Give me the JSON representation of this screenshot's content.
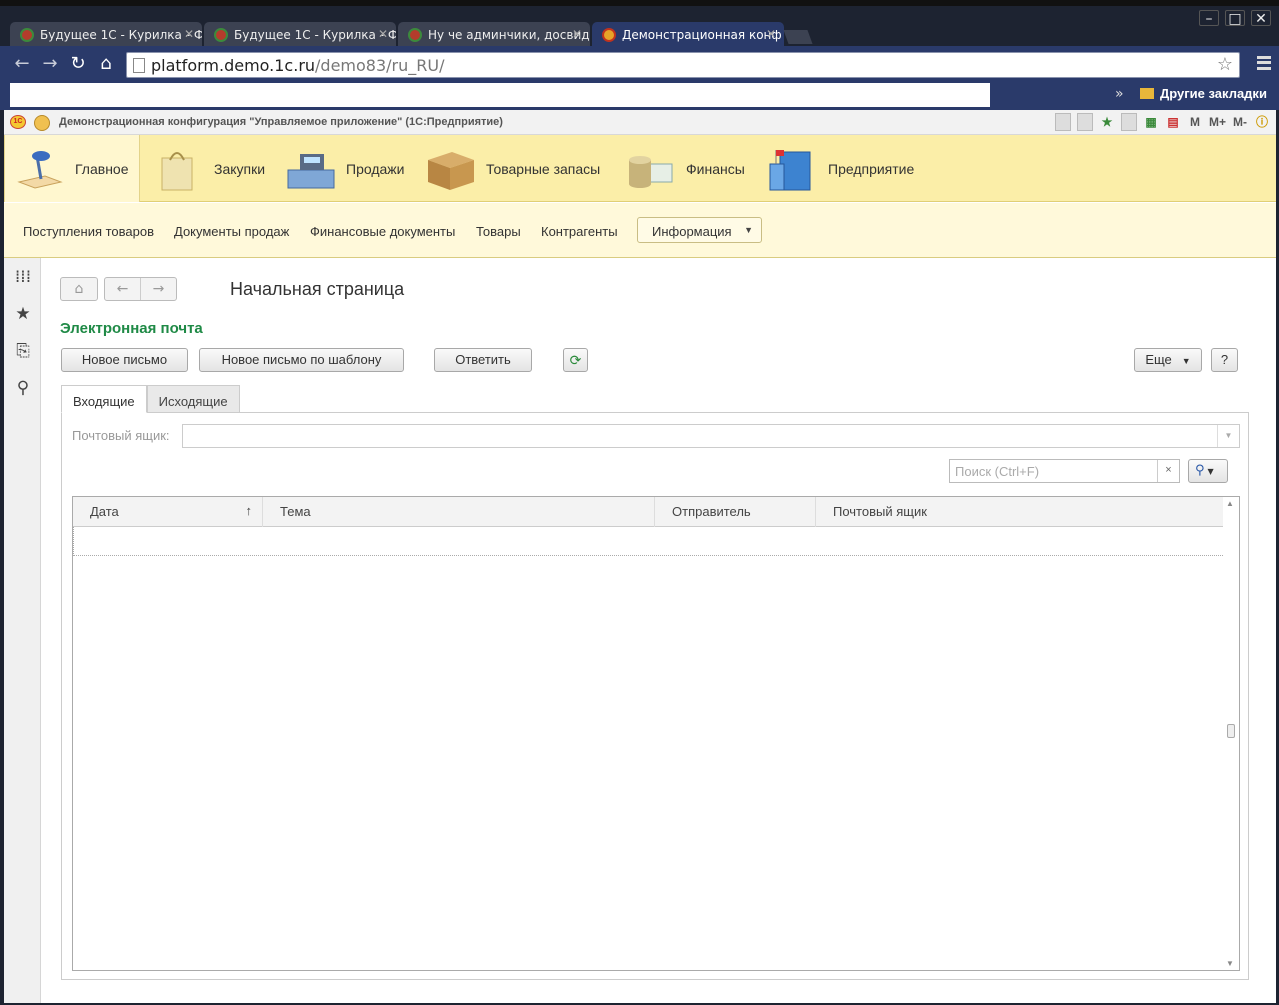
{
  "browser": {
    "tabs": [
      {
        "title": "Будущее 1С - Курилка - Ф",
        "active": false
      },
      {
        "title": "Будущее 1С - Курилка - Ф",
        "active": false
      },
      {
        "title": "Ну че админчики, досвид",
        "active": false
      },
      {
        "title": "Демонстрационная конф",
        "active": true
      }
    ],
    "url_host": "platform.demo.1c.ru",
    "url_path": "/demo83/ru_RU/",
    "bookmarks_more": "»",
    "other_bookmarks": "Другие закладки"
  },
  "app": {
    "title": "Демонстрационная конфигурация \"Управляемое приложение\"  (1С:Предприятие)",
    "toolbar_labels": {
      "m": "M",
      "m_plus": "M+",
      "m_minus": "M-"
    },
    "sections": [
      {
        "label": "Главное",
        "icon": "desk-lamp-icon"
      },
      {
        "label": "Закупки",
        "icon": "shopping-bag-icon"
      },
      {
        "label": "Продажи",
        "icon": "cash-register-icon"
      },
      {
        "label": "Товарные запасы",
        "icon": "box-icon"
      },
      {
        "label": "Финансы",
        "icon": "coins-icon"
      },
      {
        "label": "Предприятие",
        "icon": "building-icon"
      }
    ],
    "functions": [
      "Поступления товаров",
      "Документы продаж",
      "Финансовые документы",
      "Товары",
      "Контрагенты"
    ],
    "info_button": "Информация"
  },
  "content": {
    "page_title": "Начальная страница",
    "group_title": "Электронная почта",
    "buttons": {
      "new_letter": "Новое письмо",
      "new_by_template": "Новое письмо по шаблону",
      "reply": "Ответить",
      "more": "Еще",
      "help": "?"
    },
    "tabs": [
      "Входящие",
      "Исходящие"
    ],
    "mailbox_label": "Почтовый ящик:",
    "mailbox_value": "",
    "search_placeholder": "Поиск (Ctrl+F)",
    "table": {
      "columns": [
        "Дата",
        "Тема",
        "Отправитель",
        "Почтовый ящик"
      ],
      "rows": []
    }
  },
  "colors": {
    "sections_bg": "#fbeea8",
    "functions_bg": "#fff9da",
    "group_title": "#1f8a46",
    "browser_chrome": "#2a3a6a"
  }
}
